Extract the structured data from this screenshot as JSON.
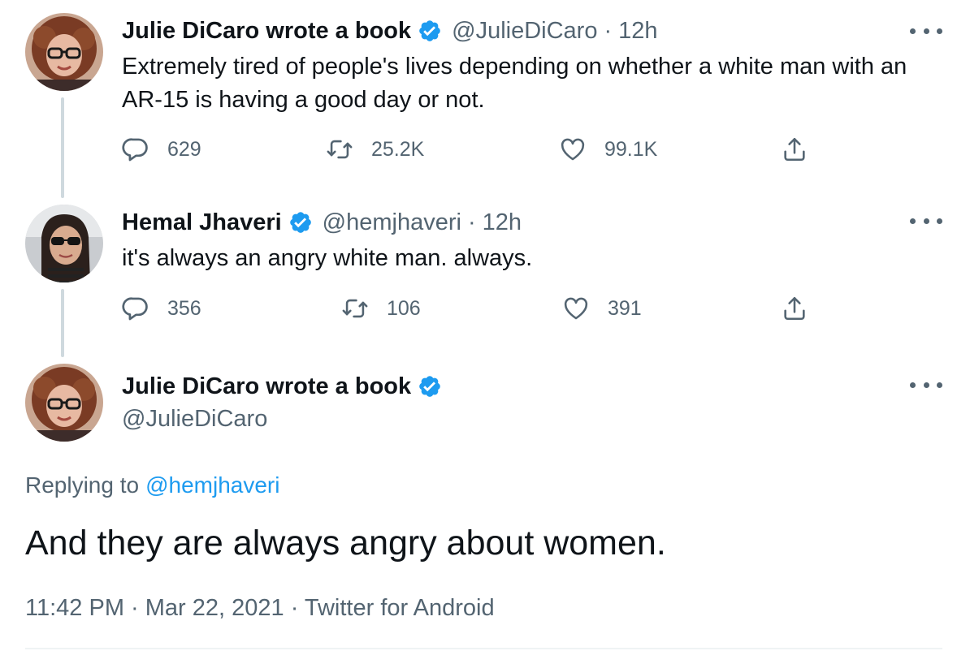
{
  "tweets": [
    {
      "name": "Julie DiCaro wrote a book",
      "handle": "@JulieDiCaro",
      "separator": "·",
      "time": "12h",
      "text": "Extremely tired of people's lives depending on whether a white man with an AR-15 is having a good day or not.",
      "reply_count": "629",
      "retweet_count": "25.2K",
      "like_count": "99.1K"
    },
    {
      "name": "Hemal Jhaveri",
      "handle": "@hemjhaveri",
      "separator": "·",
      "time": "12h",
      "text": "it's always an angry white man. always.",
      "reply_count": "356",
      "retweet_count": "106",
      "like_count": "391"
    }
  ],
  "main_tweet": {
    "name": "Julie DiCaro wrote a book",
    "handle": "@JulieDiCaro",
    "replying_prefix": "Replying to",
    "replying_handle": "@hemjhaveri",
    "text": "And they are always angry about women.",
    "timestamp": "11:42 PM · Mar 22, 2021 · Twitter for Android"
  },
  "icons": {
    "verified": "verified-badge-icon",
    "reply": "reply-icon",
    "retweet": "retweet-icon",
    "like": "heart-icon",
    "share": "share-icon",
    "more": "more-icon"
  },
  "colors": {
    "text": "#0f1419",
    "secondary": "#536471",
    "link": "#1d9bf0",
    "thread_line": "#cfd9de",
    "divider": "#eff3f4"
  }
}
